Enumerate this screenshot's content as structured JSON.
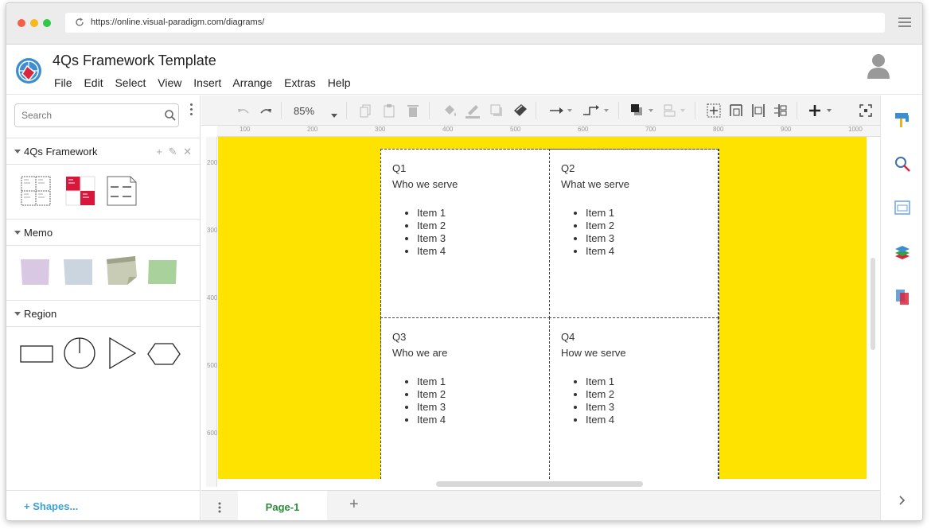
{
  "browser": {
    "url": "https://online.visual-paradigm.com/diagrams/"
  },
  "app": {
    "title": "4Qs Framework Template",
    "menu": [
      "File",
      "Edit",
      "Select",
      "View",
      "Insert",
      "Arrange",
      "Extras",
      "Help"
    ]
  },
  "sidebar": {
    "search_placeholder": "Search",
    "sections": [
      {
        "name": "4Qs Framework"
      },
      {
        "name": "Memo"
      },
      {
        "name": "Region"
      }
    ],
    "shapes_link": "+ Shapes..."
  },
  "toolbar": {
    "zoom": "85%"
  },
  "rulers": {
    "h": [
      "100",
      "200",
      "300",
      "400",
      "500",
      "600",
      "700",
      "800",
      "900",
      "1000"
    ],
    "v": [
      "200",
      "300",
      "400",
      "500",
      "600"
    ]
  },
  "diagram": {
    "quadrants": [
      {
        "id": "Q1",
        "heading": "Who we serve",
        "items": [
          "Item 1",
          "Item 2",
          "Item 3",
          "Item 4"
        ]
      },
      {
        "id": "Q2",
        "heading": "What we serve",
        "items": [
          "Item 1",
          "Item 2",
          "Item 3",
          "Item 4"
        ]
      },
      {
        "id": "Q3",
        "heading": "Who we are",
        "items": [
          "Item 1",
          "Item 2",
          "Item 3",
          "Item 4"
        ]
      },
      {
        "id": "Q4",
        "heading": "How we serve",
        "items": [
          "Item 1",
          "Item 2",
          "Item 3",
          "Item 4"
        ]
      }
    ]
  },
  "pages": {
    "tab": "Page-1",
    "add": "+"
  },
  "colors": {
    "canvas": "#ffe300",
    "page_tab": "#2e8b3d",
    "link": "#3aa3d9"
  }
}
